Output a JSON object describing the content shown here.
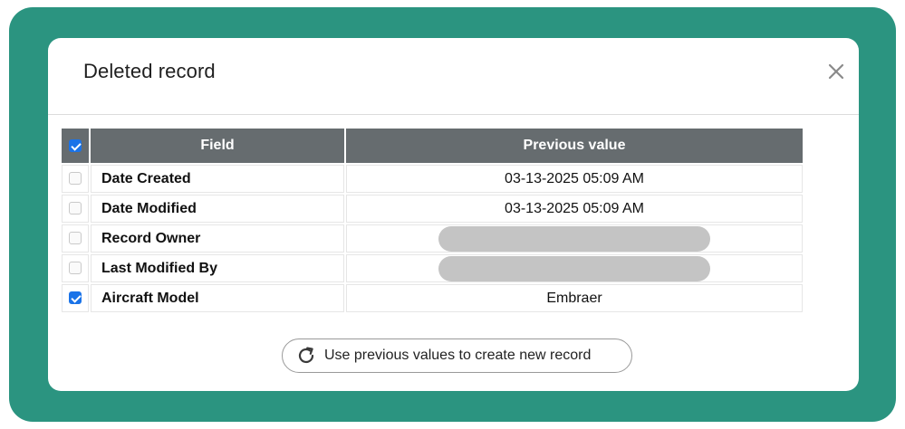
{
  "dialog": {
    "title": "Deleted record",
    "close_icon": "close-icon"
  },
  "table": {
    "header_checkbox_checked": true,
    "columns": [
      "Field",
      "Previous value"
    ],
    "rows": [
      {
        "field": "Date Created",
        "value": "03-13-2025 05:09 AM",
        "checked": false,
        "redacted": false
      },
      {
        "field": "Date Modified",
        "value": "03-13-2025 05:09 AM",
        "checked": false,
        "redacted": false
      },
      {
        "field": "Record Owner",
        "value": "",
        "checked": false,
        "redacted": true
      },
      {
        "field": "Last Modified By",
        "value": "",
        "checked": false,
        "redacted": true
      },
      {
        "field": "Aircraft Model",
        "value": "Embraer",
        "checked": true,
        "redacted": false
      }
    ]
  },
  "actions": {
    "restore_label": "Use previous values to create new record",
    "restore_icon": "refresh-icon"
  },
  "colors": {
    "frame": "#2b9480",
    "header_bg": "#666c6f",
    "checkbox_checked": "#1a73e8",
    "redaction": "#c4c4c4"
  }
}
